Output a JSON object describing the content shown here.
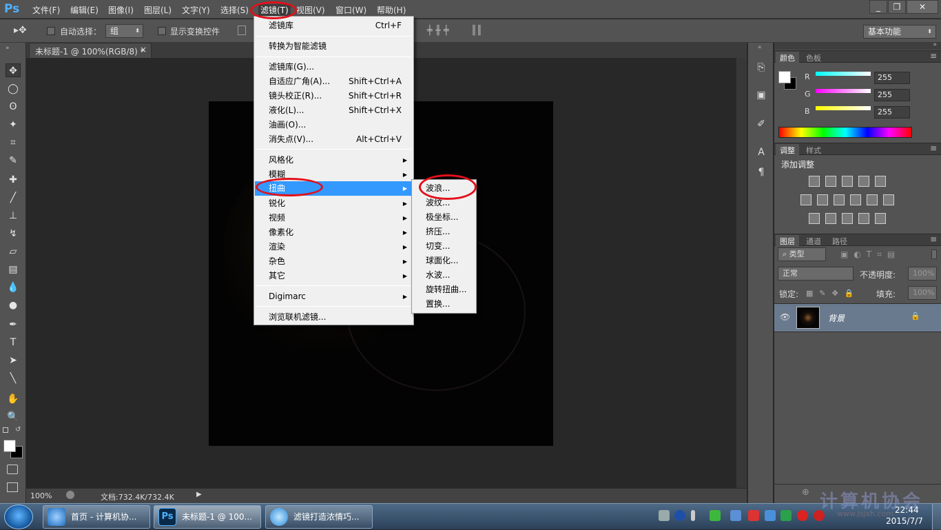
{
  "app": {
    "logo": "Ps"
  },
  "menubar": {
    "items": [
      "文件(F)",
      "编辑(E)",
      "图像(I)",
      "图层(L)",
      "文字(Y)",
      "选择(S)",
      "滤镜(T)",
      "视图(V)",
      "窗口(W)",
      "帮助(H)"
    ],
    "window_controls": [
      "_",
      "❐",
      "✕"
    ]
  },
  "options_bar": {
    "auto_select_label": "自动选择：",
    "auto_select_value": "组",
    "show_transform_label": "显示变换控件",
    "workspace_value": "基本功能"
  },
  "document": {
    "tab_title": "未标题-1 @ 100%(RGB/8) *",
    "tab_close": "×",
    "zoom": "100%",
    "doc_info": "文档:732.4K/732.4K"
  },
  "filter_menu": {
    "items": [
      {
        "label": "滤镜库",
        "shortcut": "Ctrl+F"
      },
      {
        "label": "转换为智能滤镜",
        "shortcut": ""
      },
      {
        "label": "滤镜库(G)...",
        "shortcut": ""
      },
      {
        "label": "自适应广角(A)...",
        "shortcut": "Shift+Ctrl+A"
      },
      {
        "label": "镜头校正(R)...",
        "shortcut": "Shift+Ctrl+R"
      },
      {
        "label": "液化(L)...",
        "shortcut": "Shift+Ctrl+X"
      },
      {
        "label": "油画(O)...",
        "shortcut": ""
      },
      {
        "label": "消失点(V)...",
        "shortcut": "Alt+Ctrl+V"
      },
      {
        "label": "风格化",
        "shortcut": ""
      },
      {
        "label": "模糊",
        "shortcut": ""
      },
      {
        "label": "扭曲",
        "shortcut": ""
      },
      {
        "label": "锐化",
        "shortcut": ""
      },
      {
        "label": "视频",
        "shortcut": ""
      },
      {
        "label": "像素化",
        "shortcut": ""
      },
      {
        "label": "渲染",
        "shortcut": ""
      },
      {
        "label": "杂色",
        "shortcut": ""
      },
      {
        "label": "其它",
        "shortcut": ""
      },
      {
        "label": "Digimarc",
        "shortcut": ""
      },
      {
        "label": "浏览联机滤镜...",
        "shortcut": ""
      }
    ],
    "highlighted": "扭曲"
  },
  "distort_submenu": {
    "items": [
      "波浪...",
      "波纹...",
      "极坐标...",
      "挤压...",
      "切变...",
      "球面化...",
      "水波...",
      "旋转扭曲...",
      "置换..."
    ]
  },
  "color_panel": {
    "tabs": [
      "颜色",
      "色板"
    ],
    "channels": [
      {
        "name": "R",
        "value": "255",
        "color": "#33e6e6"
      },
      {
        "name": "G",
        "value": "255",
        "color": "#e64ce6"
      },
      {
        "name": "B",
        "value": "255",
        "color": "#e6e633"
      }
    ]
  },
  "adjust_panel": {
    "tabs": [
      "调整",
      "样式"
    ],
    "heading": "添加调整"
  },
  "layers_panel": {
    "tabs": [
      "图层",
      "通道",
      "路径"
    ],
    "filter_kind": "类型",
    "blend_mode": "正常",
    "opacity_label": "不透明度:",
    "opacity_value": "100%",
    "lock_label": "锁定:",
    "fill_label": "填充:",
    "fill_value": "100%",
    "layers": [
      {
        "name": "背景"
      }
    ]
  },
  "taskbar": {
    "tasks": [
      {
        "label": "首页 - 计算机协..."
      },
      {
        "label": "未标题-1 @ 100..."
      },
      {
        "label": "滤镜打造浓情巧..."
      }
    ],
    "clock_time": "22:44",
    "clock_date": "2015/7/7",
    "watermark": "计算机协会",
    "watermark_url": "www.jsjxh.com"
  },
  "colors": {
    "ps_ui": "#535353",
    "highlight": "#3399ff",
    "annotation": "#e3101a"
  }
}
